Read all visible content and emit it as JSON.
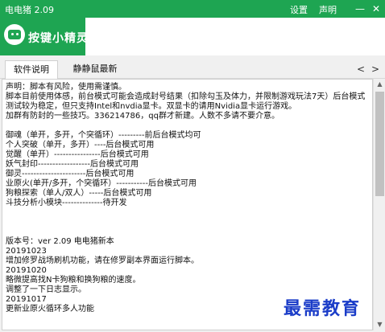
{
  "window": {
    "title": "电电猪 2.09",
    "links": [
      "设置",
      "声明"
    ],
    "minimize": "—",
    "close": "✕"
  },
  "brand": "按键小精灵",
  "tabs": [
    {
      "label": "软件说明",
      "active": true
    },
    {
      "label": "静静鼠最新",
      "active": false
    }
  ],
  "nav": {
    "prev": "<",
    "next": ">"
  },
  "content_lines": [
    "声明：脚本有风险，使用需谨慎。",
    "      脚本目前使用体感，前台模式可能会造成封号结果（扣除勾玉及体力，并限制游戏玩法7天）后台模式",
    "测试较为稳定，但只支持Intel和nvdia显卡。双显卡的请用Nvidia显卡运行游戏。",
    "加群有防封的一些技巧。336214786，qq群才新建。人数不多请不要介意。",
    "",
    "御魂（单开，多开，个突循环）---------前后台模式均可",
    "个人突破（单开，多开）----后台模式可用",
    "觉醒（单开）----------------后台模式可用",
    "妖气封印------------------后台模式可用",
    "御灵----------------------后台模式可用",
    "业原火(单开/多开，个突循环）-----------后台模式可用",
    "狗粮探索（单人/双人）-----后台模式可用",
    "斗技分析小模块--------------待开发",
    "",
    "",
    "",
    "版本号：ver 2.09 电电猪新本",
    "20191023",
    "增加修罗战场刷机功能，请在修罗副本界面运行脚本。",
    "20191020",
    "略微提高找N卡狗粮和换狗粮的速度。",
    "调整了一下日志显示。",
    "20191017",
    "更新业原火循环多人功能"
  ],
  "watermark": "最需教育"
}
